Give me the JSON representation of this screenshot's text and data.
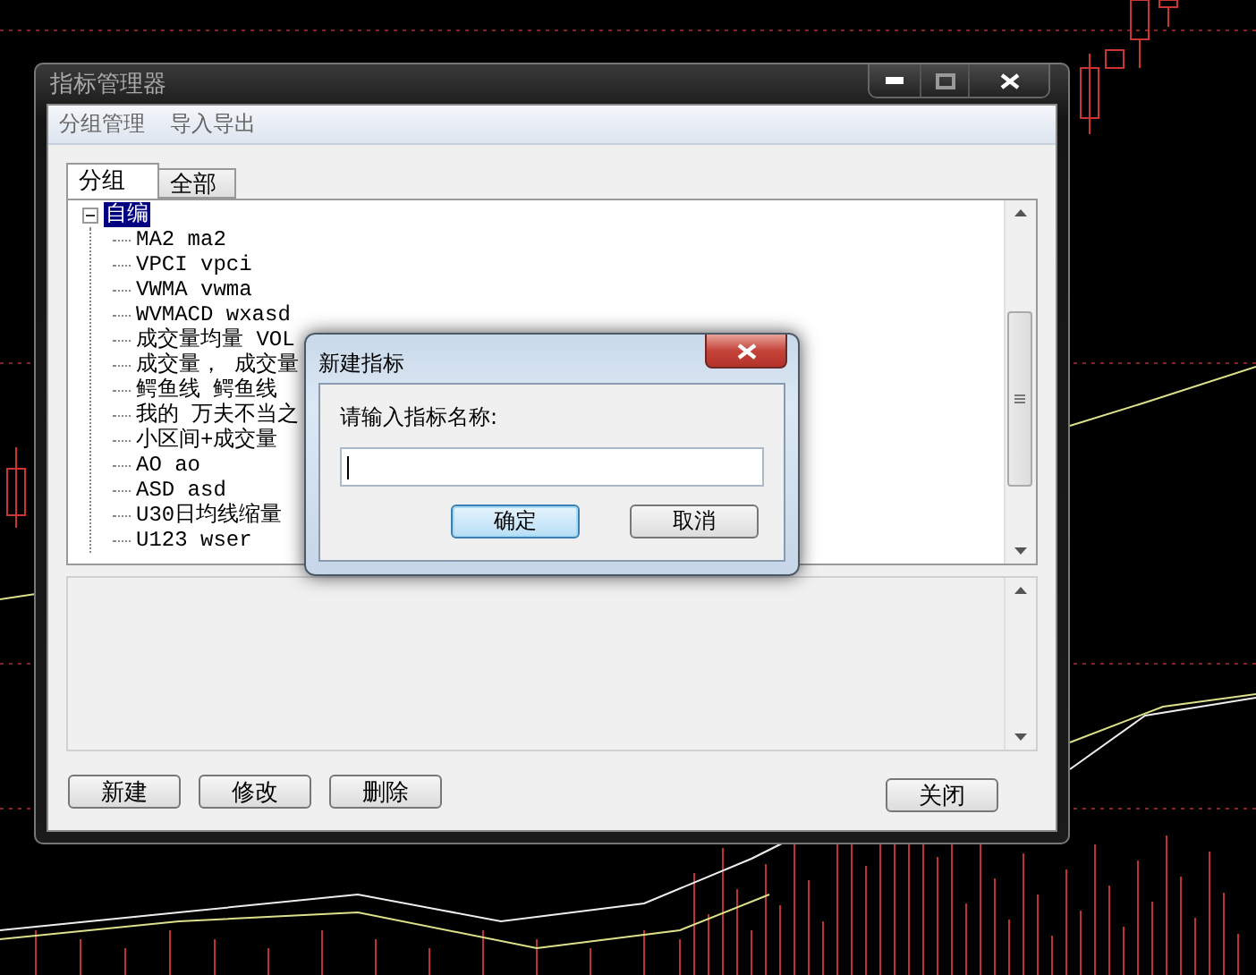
{
  "window": {
    "title": "指标管理器"
  },
  "menu": [
    "分组管理",
    "导入导出"
  ],
  "tabs": [
    {
      "label": "分组",
      "selected": true
    },
    {
      "label": "全部",
      "selected": false
    }
  ],
  "tree": [
    {
      "label": "自编",
      "expanded": true,
      "selected": true,
      "children": [
        {
          "label": "MA2 ma2",
          "selected": false
        },
        {
          "label": "VPCI vpci",
          "selected": false
        },
        {
          "label": "VWMA vwma",
          "selected": false
        },
        {
          "label": "WVMACD wxasd",
          "selected": false
        },
        {
          "label": "成交量均量 VOL",
          "selected": false
        },
        {
          "label": "成交量， 成交量",
          "selected": false
        },
        {
          "label": "鳄鱼线 鳄鱼线",
          "selected": false
        },
        {
          "label": "我的 万夫不当之",
          "selected": false
        },
        {
          "label": "小区间+成交量",
          "selected": false
        },
        {
          "label": "AO ao",
          "selected": false
        },
        {
          "label": "ASD asd",
          "selected": false
        },
        {
          "label": "U30日均线缩量",
          "selected": false
        },
        {
          "label": "U123 wser",
          "selected": false
        }
      ]
    }
  ],
  "buttons": [
    "新建",
    "修改",
    "删除"
  ],
  "close_button": "关闭",
  "dialog": {
    "title": "新建指标",
    "prompt": "请输入指标名称:",
    "buttons": [
      {
        "label": "确定",
        "default": true
      },
      {
        "label": "取消",
        "default": false
      }
    ]
  }
}
